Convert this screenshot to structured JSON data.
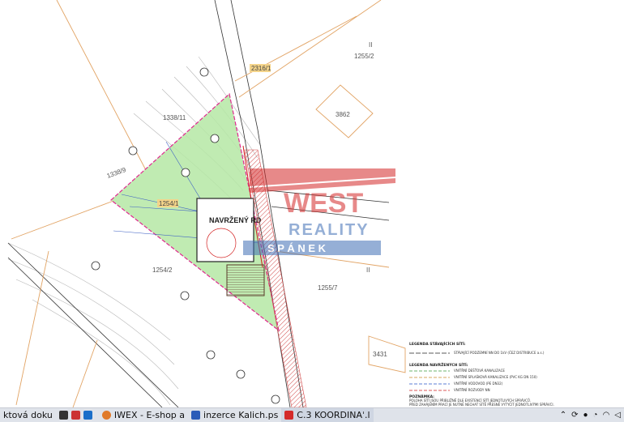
{
  "parcels": {
    "p2316_1": "2316/1",
    "p1255_2": "1255/2",
    "p3862": "3862",
    "p1338_11": "1338/11",
    "p1338_9": "1338/9",
    "p1254_1": "1254/1",
    "p1254_2": "1254/2",
    "p1255_7": "1255/7",
    "p3431": "3431",
    "roman_top": "II",
    "roman_mid": "II"
  },
  "building": {
    "label": "NAVRŽENÝ RD"
  },
  "watermark": {
    "line1": "WEST",
    "line2": "REALITY",
    "line3": "S P Á N E K"
  },
  "legend": {
    "existing_title": "LEGENDA STÁVAJÍCÍCH SÍTÍ:",
    "existing_items": [
      "STÁVAJÍCÍ PODZEMNÍ NN DO 1kV (ČEZ DISTRIBUCE a.s.)"
    ],
    "proposed_title": "LEGENDA NAVRŽENÝCH SÍTÍ:",
    "proposed_items": [
      "VNITŘNÍ DEŠŤOVÁ KANALIZACE",
      "VNITŘNÍ SPLAŠKOVÁ KANALIZACE (PVC KG DN 150)",
      "VNITŘNÍ VODOVOD (PE DN32)",
      "VNITŘNÍ ROZVODY NN"
    ],
    "notes_title": "POZNÁMKA:",
    "notes": [
      "POLOHA SÍTÍ JSOU PŘIBLIŽNÉ DLE EXISTENCÍ SÍTÍ JEDNOTLIVÝCH SPRÁVCŮ.",
      "PŘED ZAHÁJENÍM PRACÍ JE NUTNÉ NECHAT SÍTĚ PŘESNĚ VYTYČIT JEDNOTLIVÝMI SPRÁVCI."
    ]
  },
  "taskbar": {
    "items": [
      "ktová doku",
      "IWEX - E-shop a",
      "inzerce Kalich.ps",
      "C.3 KOORDINAˈ.l"
    ]
  },
  "colors": {
    "plot_fill": "#b5e8a5",
    "plot_border": "#e0288f",
    "parcel_line": "#e2a465",
    "road_hatch": "#d24a4a",
    "watermark_red": "#d42a2a",
    "watermark_blue": "#3f6fb5"
  }
}
